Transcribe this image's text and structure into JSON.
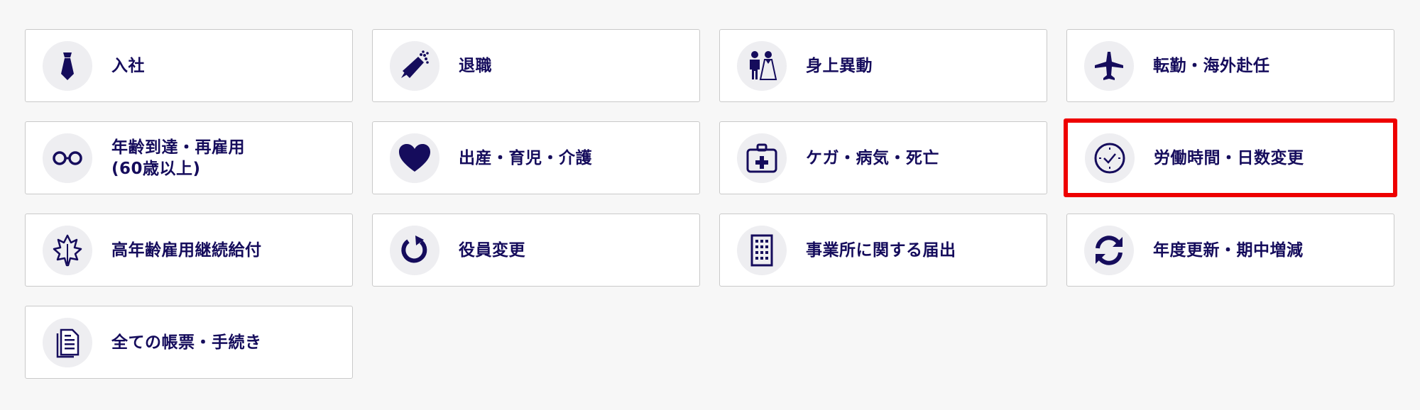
{
  "cards": [
    {
      "label": "入社",
      "icon": "necktie-icon"
    },
    {
      "label": "退職",
      "icon": "bouquet-icon"
    },
    {
      "label": "身上異動",
      "icon": "wedding-couple-icon"
    },
    {
      "label": "転勤・海外赴任",
      "icon": "airplane-icon"
    },
    {
      "label": "年齢到達・再雇用\n(60歳以上)",
      "icon": "glasses-icon"
    },
    {
      "label": "出産・育児・介護",
      "icon": "heart-icon"
    },
    {
      "label": "ケガ・病気・死亡",
      "icon": "first-aid-kit-icon"
    },
    {
      "label": "労働時間・日数変更",
      "icon": "clock-icon",
      "highlighted": true
    },
    {
      "label": "高年齢雇用継続給付",
      "icon": "maple-leaf-icon"
    },
    {
      "label": "役員変更",
      "icon": "rotate-arrow-icon"
    },
    {
      "label": "事業所に関する届出",
      "icon": "office-building-icon"
    },
    {
      "label": "年度更新・期中増減",
      "icon": "refresh-arrows-icon"
    },
    {
      "label": "全ての帳票・手続き",
      "icon": "documents-icon"
    }
  ],
  "colors": {
    "primary": "#150c5c",
    "icon_bg": "#eeeef1",
    "highlight_border": "#ee0000",
    "card_border": "#c9c9c9",
    "page_bg": "#f7f7f7"
  }
}
